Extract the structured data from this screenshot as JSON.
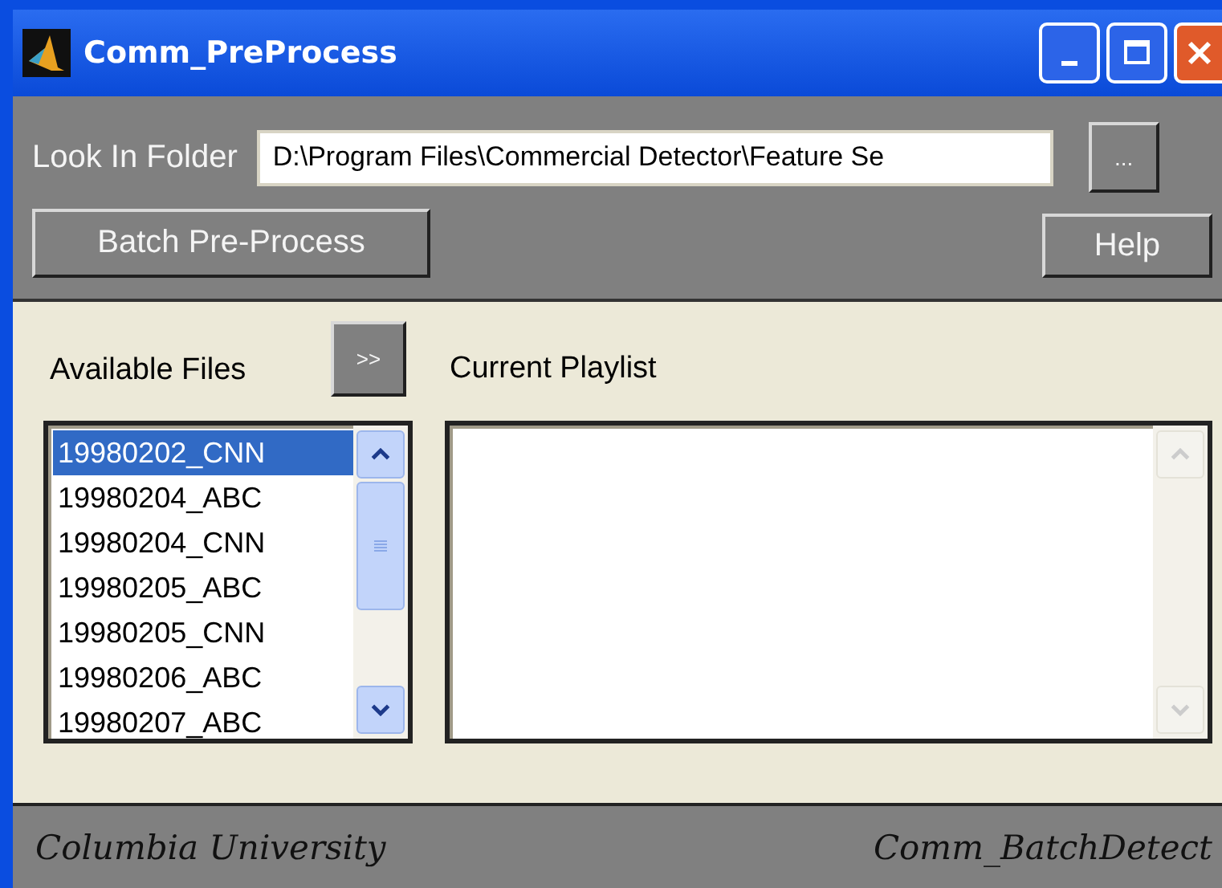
{
  "window": {
    "title": "Comm_PreProcess"
  },
  "folder": {
    "label": "Look In Folder",
    "value": "D:\\Program Files\\Commercial Detector\\Feature Se",
    "browse_button": "..."
  },
  "buttons": {
    "batch": "Batch Pre-Process",
    "help": "Help",
    "add": ">>"
  },
  "available": {
    "label": "Available Files",
    "items": [
      {
        "text": "19980202_CNN",
        "selected": true
      },
      {
        "text": "19980204_ABC",
        "selected": false
      },
      {
        "text": "19980204_CNN",
        "selected": false
      },
      {
        "text": "19980205_ABC",
        "selected": false
      },
      {
        "text": "19980205_CNN",
        "selected": false
      },
      {
        "text": "19980206_ABC",
        "selected": false
      },
      {
        "text": "19980207_ABC",
        "selected": false
      }
    ]
  },
  "playlist": {
    "label": "Current Playlist"
  },
  "status_bar": {
    "left": "Columbia University",
    "right": "Comm_BatchDetect"
  }
}
